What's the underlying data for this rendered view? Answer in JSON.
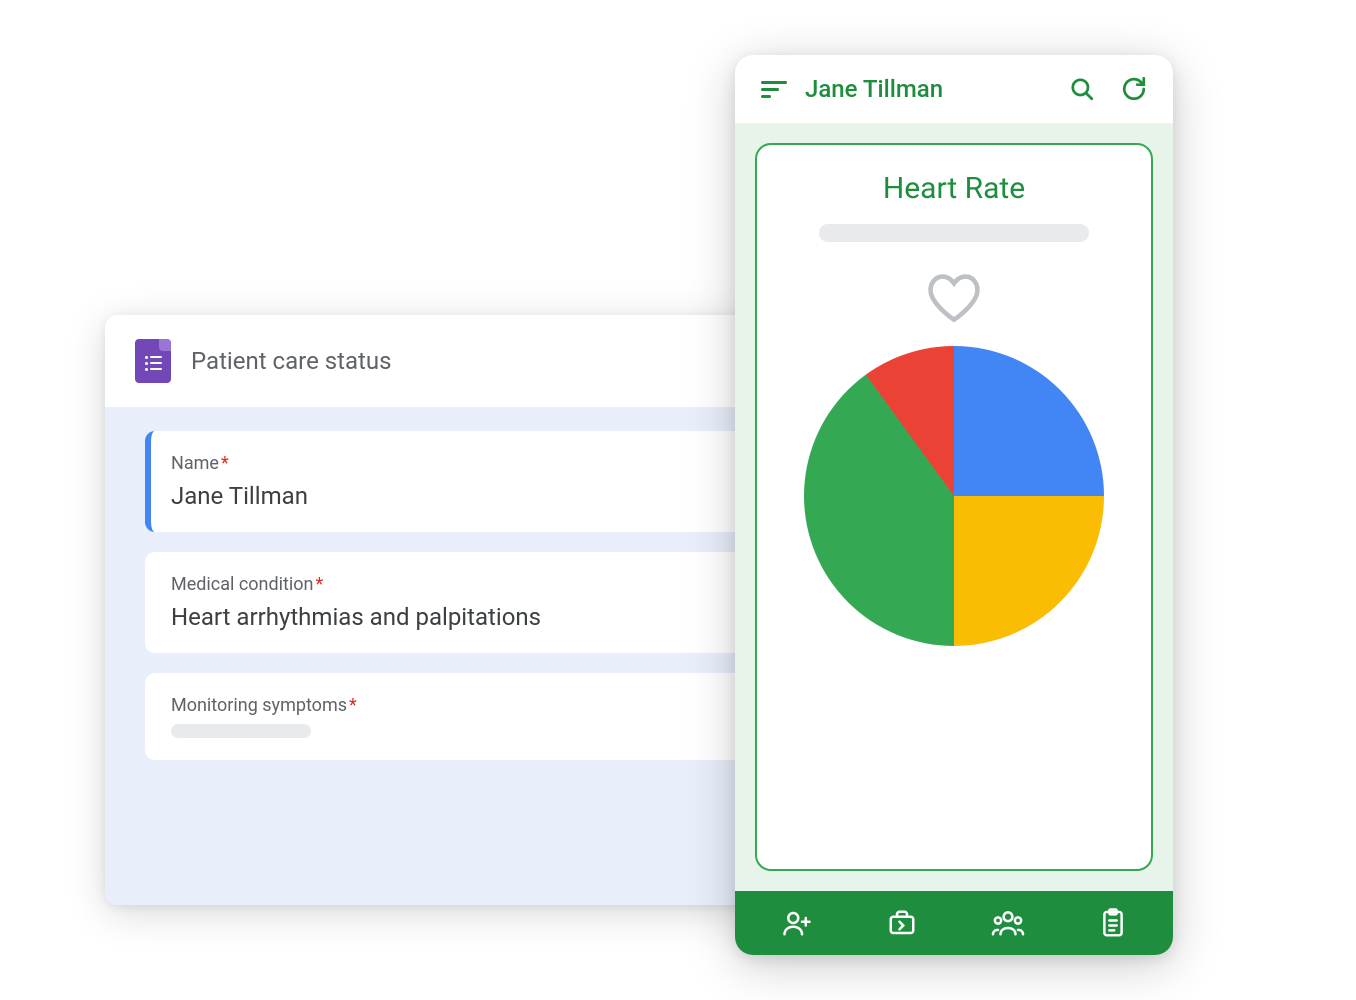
{
  "form": {
    "title": "Patient care status",
    "fields": [
      {
        "label": "Name",
        "required": true,
        "value": "Jane Tillman",
        "active": true
      },
      {
        "label": "Medical condition",
        "required": true,
        "value": "Heart arrhythmias and palpitations",
        "active": false
      },
      {
        "label": "Monitoring symptoms",
        "required": true,
        "value": "",
        "active": false
      }
    ]
  },
  "mobile": {
    "patient_name": "Jane Tillman",
    "card_title": "Heart Rate",
    "tabs": [
      "add-person",
      "briefcase",
      "group",
      "clipboard"
    ]
  },
  "colors": {
    "green": "#1e8e3e",
    "green_light": "#E6F4EA",
    "green_border": "#34A853",
    "blue": "#4285F4",
    "yellow": "#FBBC04",
    "red": "#EA4335",
    "purple": "#7248B9",
    "form_body_bg": "#E8EEFA"
  },
  "chart_data": {
    "type": "pie",
    "title": "Heart Rate",
    "slices": [
      {
        "name": "blue",
        "color": "#4285F4",
        "value": 25
      },
      {
        "name": "yellow",
        "color": "#FBBC04",
        "value": 25
      },
      {
        "name": "green",
        "color": "#34A853",
        "value": 40
      },
      {
        "name": "red",
        "color": "#EA4335",
        "value": 10
      }
    ]
  }
}
